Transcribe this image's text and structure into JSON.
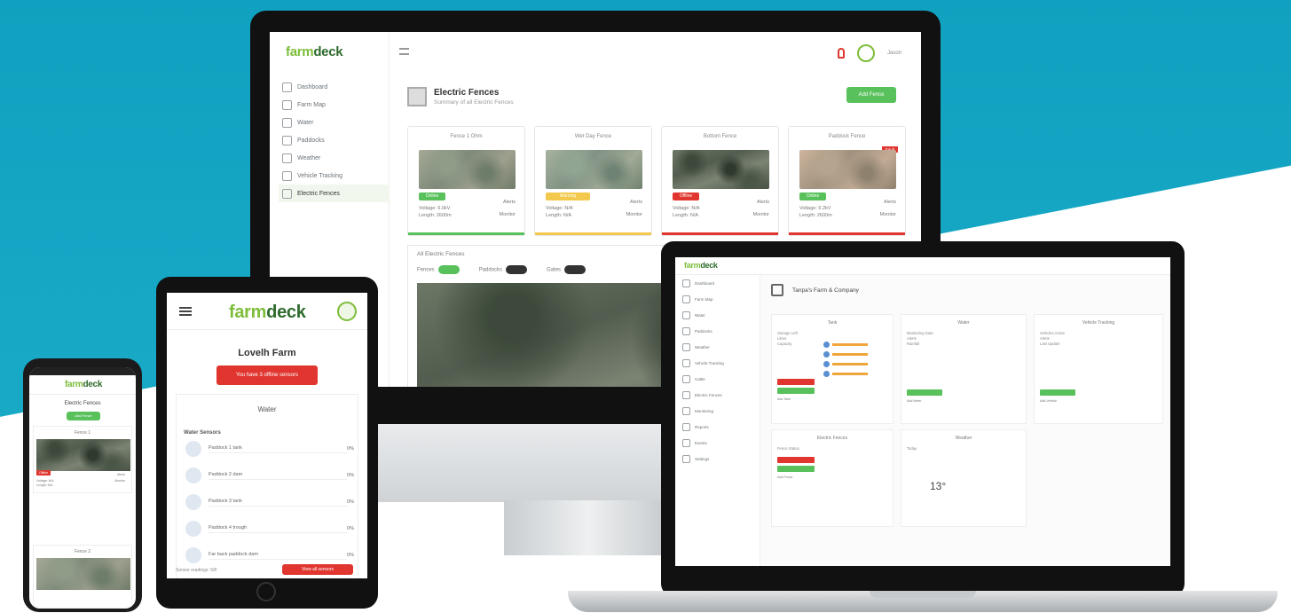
{
  "monitor": {
    "logo_left": "farm",
    "logo_right": "deck",
    "user_label": "Jason",
    "nav": [
      {
        "label": "Dashboard",
        "icon": "dashboard-icon"
      },
      {
        "label": "Farm Map",
        "icon": "map-icon"
      },
      {
        "label": "Water",
        "icon": "water-icon"
      },
      {
        "label": "Paddocks",
        "icon": "paddock-icon"
      },
      {
        "label": "Weather",
        "icon": "weather-icon"
      },
      {
        "label": "Vehicle Tracking",
        "icon": "vehicle-icon"
      },
      {
        "label": "Electric Fences",
        "icon": "fence-icon"
      }
    ],
    "page_title": "Electric Fences",
    "page_subtitle": "Summary of all Electric Fences",
    "add_button": "Add Fence",
    "cards": [
      {
        "title": "Fence 1 Ohm",
        "status": "Online",
        "status_color": "#59c15b",
        "voltage": "Voltage: 6.0kV",
        "length": "Length: 2600m",
        "action1": "Alerts",
        "action2": "Monitor",
        "bar_color": "#59c15b",
        "flag": ""
      },
      {
        "title": "Wet Day Fence",
        "status": "Warning",
        "status_color": "#f2c94c",
        "voltage": "Voltage: N/A",
        "length": "Length: N/A",
        "action1": "Alerts",
        "action2": "Monitor",
        "bar_color": "#f2c94c",
        "flag": ""
      },
      {
        "title": "Bottom Fence",
        "status": "Offline",
        "status_color": "#e0362f",
        "voltage": "Voltage: N/A",
        "length": "Length: N/A",
        "action1": "Alerts",
        "action2": "Monitor",
        "bar_color": "#e0362f",
        "flag": ""
      },
      {
        "title": "Paddock Fence",
        "status": "Online",
        "status_color": "#59c15b",
        "voltage": "Voltage: 6.2kV",
        "length": "Length: 2600m",
        "action1": "Alerts",
        "action2": "Monitor",
        "bar_color": "#e0362f",
        "flag": "Fault"
      }
    ],
    "map_title": "All Electric Fences",
    "toggles": [
      {
        "label": "Fences",
        "state": "on"
      },
      {
        "label": "Paddocks",
        "state": "off"
      },
      {
        "label": "Gates",
        "state": "off"
      }
    ]
  },
  "laptop": {
    "logo_left": "farm",
    "logo_right": "deck",
    "page_title": "Tanpa's Farm & Company",
    "nav": [
      "Dashboard",
      "Farm Map",
      "Water",
      "Paddocks",
      "Weather",
      "Vehicle Tracking",
      "Cattle",
      "Electric Fences",
      "Monitoring",
      "Reports",
      "Events",
      "Settings"
    ],
    "panels": {
      "tanks": {
        "title": "Tank",
        "sub": [
          "Storage Left",
          "Litres",
          "Capacity"
        ],
        "add": "Add Tank"
      },
      "water": {
        "title": "Water",
        "sub": [
          "Monitoring Data",
          "Alerts",
          "Rainfall"
        ],
        "add": "Add Meter"
      },
      "vehicle": {
        "title": "Vehicle Tracking",
        "sub": [
          "Vehicles Active",
          "Alerts",
          "Last Update"
        ],
        "add": "Add Vehicle"
      },
      "fences": {
        "title": "Electric Fences",
        "sub": [
          "Fence Status"
        ],
        "add": "Add Fence"
      },
      "weather": {
        "title": "Weather",
        "sub": [
          "Today"
        ],
        "temp": "13°"
      }
    }
  },
  "tablet": {
    "logo_left": "farm",
    "logo_right": "deck",
    "farm_name": "Lovelh Farm",
    "alert_button": "You have 3 offline sensors",
    "card_title": "Water",
    "section_label": "Water Sensors",
    "items": [
      {
        "name": "Paddock 1 tank",
        "pct": "0%"
      },
      {
        "name": "Paddock 2 dam",
        "pct": "0%"
      },
      {
        "name": "Paddock 3 tank",
        "pct": "0%"
      },
      {
        "name": "Paddock 4 trough",
        "pct": "0%"
      },
      {
        "name": "Far back paddock dam",
        "pct": "0%"
      }
    ],
    "footer_text": "Sensor readings: 5/8",
    "footer_button": "View all sensors"
  },
  "phone": {
    "logo_left": "farm",
    "logo_right": "deck",
    "page_title": "Electric Fences",
    "add_button": "Add Fence",
    "card1_title": "Fence 1",
    "card1_status": "Offline",
    "card1_meta": [
      "Voltage: N/A",
      "Length: N/A"
    ],
    "card1_actions": [
      "Alerts",
      "Monitor"
    ],
    "card2_title": "Fence 2"
  }
}
